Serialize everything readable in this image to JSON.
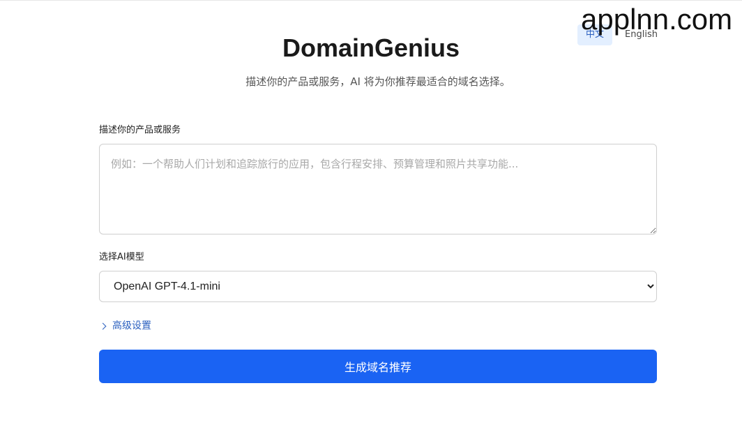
{
  "watermark": "applnn.com",
  "language": {
    "options": [
      {
        "label": "中文",
        "active": true
      },
      {
        "label": "English",
        "active": false
      }
    ]
  },
  "header": {
    "title": "DomainGenius",
    "subtitle": "描述你的产品或服务，AI 将为你推荐最适合的域名选择。"
  },
  "form": {
    "description_label": "描述你的产品或服务",
    "description_value": "",
    "description_placeholder": "例如：一个帮助人们计划和追踪旅行的应用，包含行程安排、预算管理和照片共享功能...",
    "model_label": "选择AI模型",
    "model_selected": "OpenAI GPT-4.1-mini",
    "advanced_label": "高级设置",
    "submit_label": "生成域名推荐"
  },
  "colors": {
    "accent": "#1a63f3",
    "link": "#2a5fbf",
    "lang_active_bg": "#e3efff"
  },
  "icons": {
    "advanced": "chevron-right-icon"
  }
}
